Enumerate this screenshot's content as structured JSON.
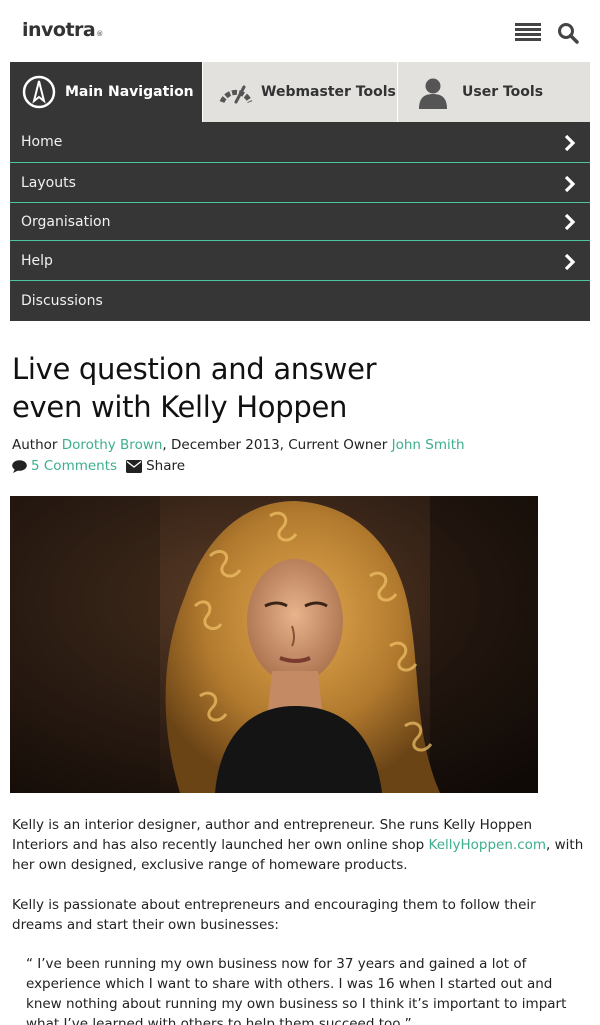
{
  "brand": {
    "logo": "invotra",
    "mark": "®"
  },
  "tabs": [
    {
      "label": "Main Navigation",
      "icon": "compass-icon",
      "active": true
    },
    {
      "label": "Webmaster Tools",
      "icon": "gauge-icon",
      "active": false
    },
    {
      "label": "User Tools",
      "icon": "user-icon",
      "active": false
    }
  ],
  "nav": {
    "items": [
      {
        "label": "Home",
        "has_children": true
      },
      {
        "label": "Layouts",
        "has_children": true
      },
      {
        "label": "Organisation",
        "has_children": true
      },
      {
        "label": "Help",
        "has_children": true
      },
      {
        "label": "Discussions",
        "has_children": false
      }
    ]
  },
  "article": {
    "title_line1": "Live question and answer",
    "title_line2": "even with Kelly Hoppen",
    "author_prefix": "Author",
    "author": "Dorothy Brown",
    "date_text": ", December 2013, Current Owner",
    "owner": "John Smith",
    "comments": "5 Comments",
    "share": "Share",
    "p1_a": "Kelly is an interior designer, author and entrepreneur. She runs Kelly Hoppen Interiors and has also recently launched her own online shop",
    "p1_link": "KellyHoppen.com",
    "p1_b": ", with her own designed, exclusive range of homeware products.",
    "p2": "Kelly is passionate about entrepreneurs and encouraging them to follow their dreams and start their own businesses:",
    "quote": "“ I’ve been running my own business now for 37 years and gained a lot of experience which I want to share with others. I was 16 when I started out and knew nothing about running my own business so I think it’s important to impart what I’ve learned with others to help them succeed too.”"
  },
  "colors": {
    "accent": "#3dae8f",
    "nav_bg": "#363636",
    "nav_divider": "#4dc3a2",
    "tab_bg": "#e3e1dd"
  }
}
